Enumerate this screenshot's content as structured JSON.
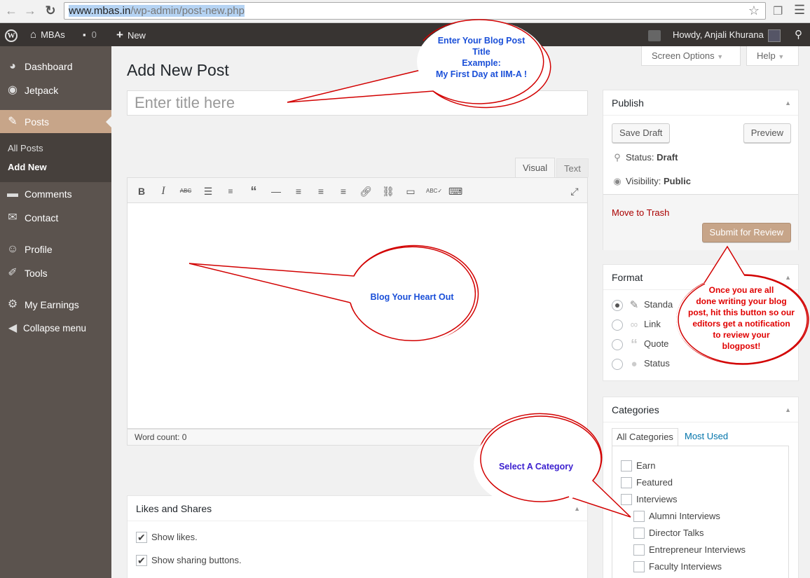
{
  "browser": {
    "url_domain": "www.mbas.in",
    "url_path": "/wp-admin/post-new.php"
  },
  "adminbar": {
    "site_name": "MBAs",
    "comments_count": "0",
    "new_label": "New",
    "greeting": "Howdy, Anjali Khurana"
  },
  "sidebar": {
    "items": [
      {
        "label": "Dashboard",
        "icon": "dashboard-icon"
      },
      {
        "label": "Jetpack",
        "icon": "jetpack-icon"
      },
      {
        "label": "Posts",
        "icon": "pin-icon"
      },
      {
        "label": "Comments",
        "icon": "comment-icon"
      },
      {
        "label": "Contact",
        "icon": "mail-icon"
      },
      {
        "label": "Profile",
        "icon": "user-icon"
      },
      {
        "label": "Tools",
        "icon": "wrench-icon"
      },
      {
        "label": "My Earnings",
        "icon": "gear-icon"
      },
      {
        "label": "Collapse menu",
        "icon": "collapse-icon"
      }
    ],
    "submenu": [
      "All Posts",
      "Add New"
    ]
  },
  "main": {
    "page_title": "Add New Post",
    "screen_options": "Screen Options",
    "help": "Help",
    "title_placeholder": "Enter title here",
    "tab_visual": "Visual",
    "tab_text": "Text",
    "word_count": "Word count: 0"
  },
  "publish": {
    "heading": "Publish",
    "save_draft": "Save Draft",
    "preview": "Preview",
    "status_label": "Status:",
    "status_value": "Draft",
    "visibility_label": "Visibility:",
    "visibility_value": "Public",
    "move_to_trash": "Move to Trash",
    "submit": "Submit for Review"
  },
  "format": {
    "heading": "Format",
    "options": [
      {
        "label": "Standa",
        "icon": "pin-icon",
        "selected": true
      },
      {
        "label": "Link",
        "icon": "link-icon",
        "selected": false
      },
      {
        "label": "Quote",
        "icon": "quote-icon",
        "selected": false
      },
      {
        "label": "Status",
        "icon": "status-icon",
        "selected": false
      }
    ]
  },
  "categories": {
    "heading": "Categories",
    "tab_all": "All Categories",
    "tab_used": "Most Used",
    "items": [
      {
        "label": "Earn",
        "level": 0
      },
      {
        "label": "Featured",
        "level": 0
      },
      {
        "label": "Interviews",
        "level": 0
      },
      {
        "label": "Alumni Interviews",
        "level": 1
      },
      {
        "label": "Director Talks",
        "level": 1
      },
      {
        "label": "Entrepreneur Interviews",
        "level": 1
      },
      {
        "label": "Faculty Interviews",
        "level": 1
      }
    ]
  },
  "likes": {
    "heading": "Likes and Shares",
    "show_likes": "Show likes.",
    "show_sharing": "Show sharing buttons."
  },
  "callouts": {
    "title_line1": "Enter Your Blog Post",
    "title_line2": "Title",
    "title_line3": "Example:",
    "title_line4": "My First Day at IIM-A !",
    "body": "Blog Your Heart Out",
    "review_line1": "Once you are all",
    "review_line2": "done writing your blog",
    "review_line3": "post, hit this button so our",
    "review_line4": "editors get a notification",
    "review_line5": "to review your",
    "review_line6": "blogpost!",
    "category": "Select A Category"
  },
  "colors": {
    "sidebar_bg": "#5b534e",
    "accent": "#c7a589",
    "adminbar_bg": "#383432",
    "trash_red": "#a00000",
    "link_blue": "#0073aa"
  }
}
